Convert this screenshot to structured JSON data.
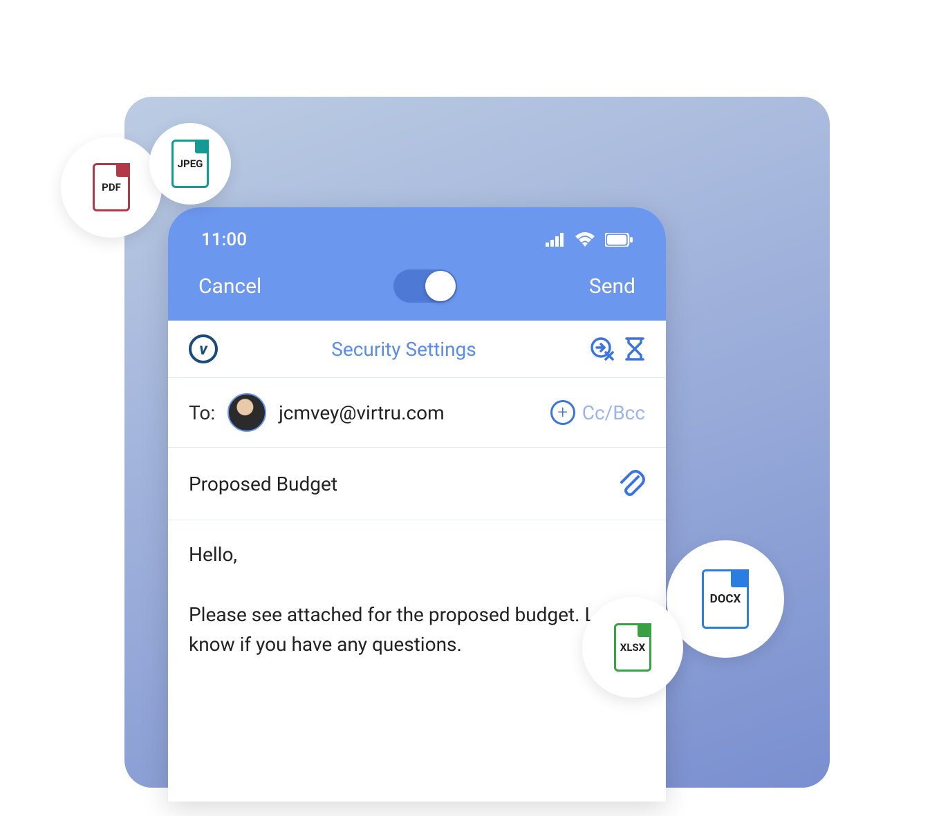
{
  "status": {
    "time": "11:00"
  },
  "nav": {
    "cancel": "Cancel",
    "send": "Send"
  },
  "security": {
    "label": "Security Settings"
  },
  "to": {
    "label": "To:",
    "email": "jcmvey@virtru.com",
    "ccbcc": "Cc/Bcc",
    "add": "+"
  },
  "subject": "Proposed Budget",
  "body": "Hello,\n\nPlease see attached for the proposed budget. Let me know if you have any questions.",
  "badges": {
    "pdf": "PDF",
    "jpeg": "JPEG",
    "docx": "DOCX",
    "xlsx": "XLSX"
  }
}
